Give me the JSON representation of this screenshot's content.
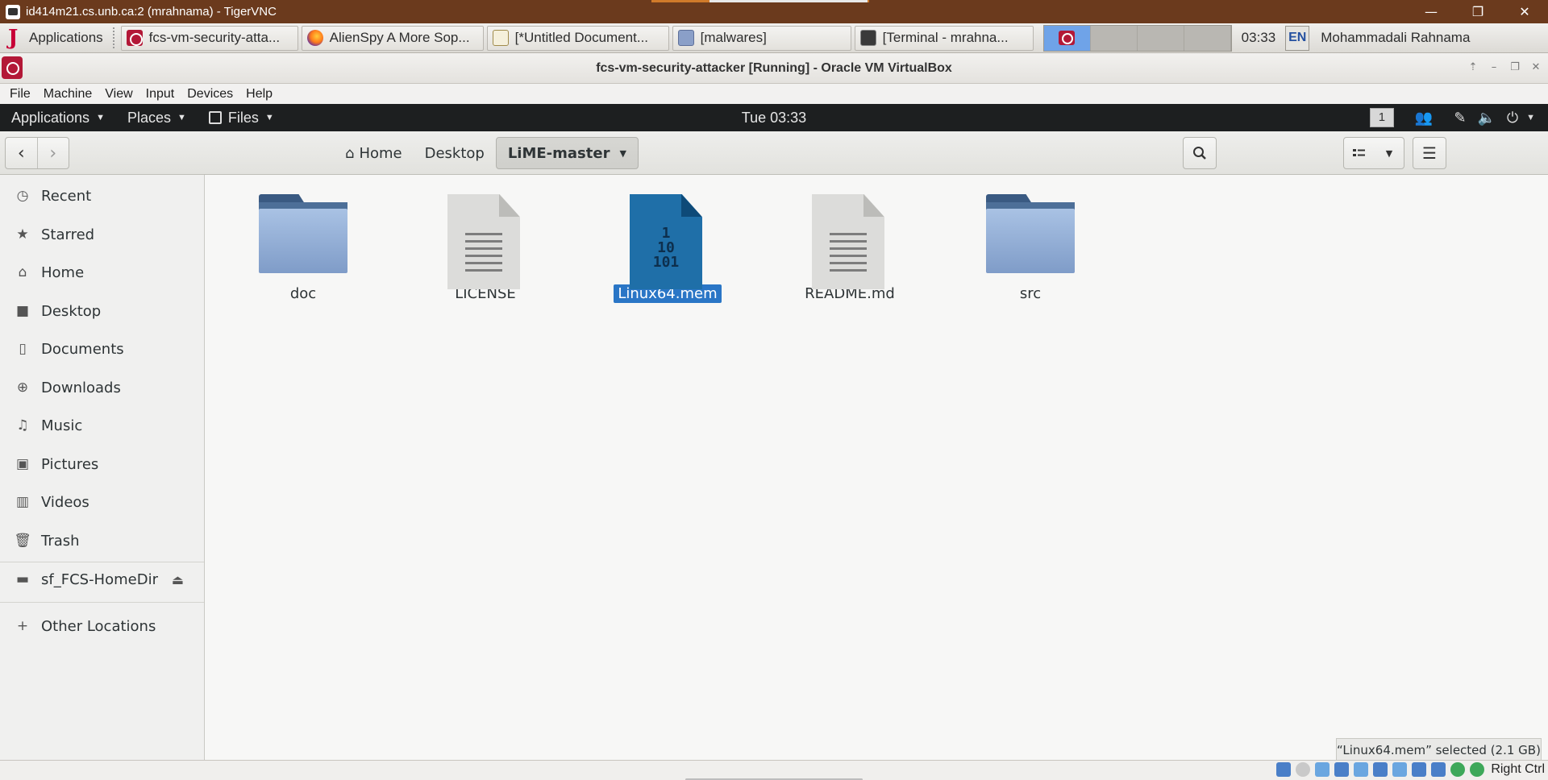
{
  "vnc": {
    "title": "id414m21.cs.unb.ca:2 (mrahnama) - TigerVNC",
    "minimize_glyph": "—",
    "restore_glyph": "❐",
    "close_glyph": "✕"
  },
  "host_panel": {
    "apps_label": "Applications",
    "tasks": [
      {
        "label": "fcs-vm-security-atta...",
        "icon": "virtualbox-icon"
      },
      {
        "label": "AlienSpy A More Sop...",
        "icon": "firefox-icon"
      },
      {
        "label": "[*Untitled Document...",
        "icon": "text-editor-icon"
      },
      {
        "label": "[malwares]",
        "icon": "file-manager-icon"
      },
      {
        "label": "[Terminal - mrahna...",
        "icon": "terminal-icon"
      }
    ],
    "clock": "03:33",
    "lang": "EN",
    "user": "Mohammadali Rahnama"
  },
  "vbox": {
    "title": "fcs-vm-security-attacker [Running] - Oracle VM VirtualBox",
    "menu": [
      "File",
      "Machine",
      "View",
      "Input",
      "Devices",
      "Help"
    ],
    "host_key": "Right Ctrl"
  },
  "gnome": {
    "applications": "Applications",
    "places": "Places",
    "files": "Files",
    "clock": "Tue 03:33",
    "workspace": "1"
  },
  "nautilus": {
    "breadcrumbs": {
      "home": "Home",
      "desktop": "Desktop",
      "current": "LiME-master"
    },
    "sidebar": {
      "items": [
        {
          "label": "Recent",
          "icon": "clock-icon"
        },
        {
          "label": "Starred",
          "icon": "star-icon"
        },
        {
          "label": "Home",
          "icon": "home-icon"
        },
        {
          "label": "Desktop",
          "icon": "desktop-icon"
        },
        {
          "label": "Documents",
          "icon": "document-icon"
        },
        {
          "label": "Downloads",
          "icon": "download-icon"
        },
        {
          "label": "Music",
          "icon": "music-icon"
        },
        {
          "label": "Pictures",
          "icon": "picture-icon"
        },
        {
          "label": "Videos",
          "icon": "video-icon"
        },
        {
          "label": "Trash",
          "icon": "trash-icon"
        },
        {
          "label": "sf_FCS-HomeDir",
          "icon": "drive-icon"
        },
        {
          "label": "Other Locations",
          "icon": "plus-icon"
        }
      ]
    },
    "files": [
      {
        "name": "doc",
        "type": "folder"
      },
      {
        "name": "LICENSE",
        "type": "text"
      },
      {
        "name": "Linux64.mem",
        "type": "binary",
        "selected": true
      },
      {
        "name": "README.md",
        "type": "text"
      },
      {
        "name": "src",
        "type": "folder"
      }
    ],
    "binary_glyph": "1\n10\n101",
    "status": "“Linux64.mem” selected  (2.1 GB)"
  },
  "colors": {
    "selection": "#2a76c6",
    "vnc_titlebar": "#6b3a1d",
    "gnome_topbar": "#1d1f20",
    "folder_blue": "#7f9cc8",
    "binary_file": "#1f6fa8"
  }
}
